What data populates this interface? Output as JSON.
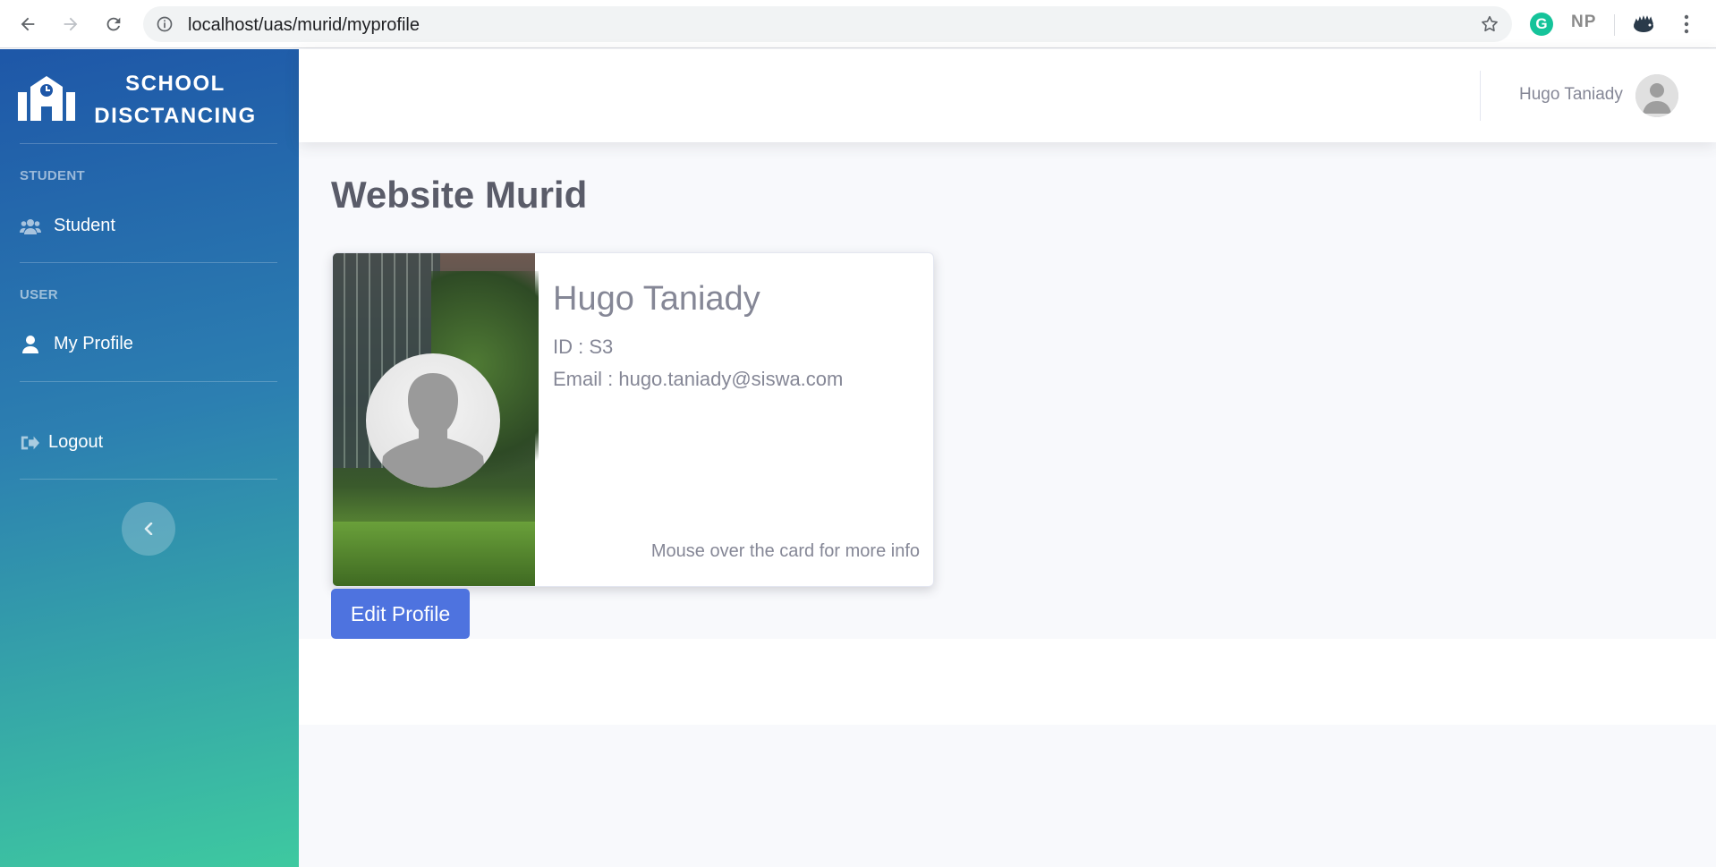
{
  "browser": {
    "url": "localhost/uas/murid/myprofile",
    "ext_np": "NP",
    "ext_g": "G"
  },
  "sidebar": {
    "brand_line1": "SCHOOL",
    "brand_line2": "DISCTANCING",
    "sections": [
      {
        "heading": "STUDENT",
        "item": "Student",
        "icon": "users-icon"
      },
      {
        "heading": "USER",
        "item": "My Profile",
        "icon": "user-icon"
      }
    ],
    "logout": "Logout"
  },
  "topbar": {
    "username": "Hugo Taniady"
  },
  "main": {
    "page_title": "Website Murid",
    "card": {
      "name": "Hugo Taniady",
      "id_line": "ID : S3",
      "email_line": "Email : hugo.taniady@siswa.com",
      "hint": "Mouse over the card for more info"
    },
    "edit_button": "Edit Profile"
  },
  "colors": {
    "primary": "#4e73df",
    "sidebar_top": "#1e57a8",
    "sidebar_bottom": "#3ec9a0",
    "text_muted": "#858796"
  }
}
